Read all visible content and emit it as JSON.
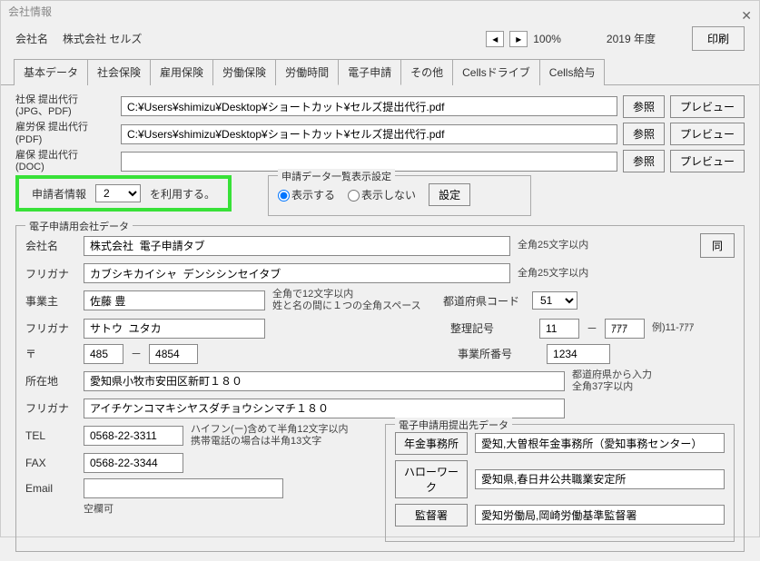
{
  "window": {
    "title": "会社情報"
  },
  "header": {
    "company_label": "会社名",
    "company_name": "株式会社 セルズ",
    "zoom": "100%",
    "year_value": "2019",
    "year_suffix": "年度",
    "print": "印刷"
  },
  "tabs": {
    "items": [
      "基本データ",
      "社会保険",
      "雇用保険",
      "労働保険",
      "労働時間",
      "電子申請",
      "その他",
      "Cellsドライブ",
      "Cells給与"
    ],
    "active": 5
  },
  "files": {
    "r0": {
      "label": "社保 提出代行\n(JPG、PDF)",
      "value": "C:¥Users¥shimizu¥Desktop¥ショートカット¥セルズ提出代行.pdf"
    },
    "r1": {
      "label": "雇労保 提出代行\n(PDF)",
      "value": "C:¥Users¥shimizu¥Desktop¥ショートカット¥セルズ提出代行.pdf"
    },
    "r2": {
      "label": "雇保 提出代行\n(DOC)",
      "value": ""
    },
    "browse": "参照",
    "preview": "プレビュー"
  },
  "applicant": {
    "label": "申請者情報",
    "value": "2",
    "suffix": "を利用する。"
  },
  "display_setting": {
    "legend": "申請データ一覧表示設定",
    "opt_show": "表示する",
    "opt_hide": "表示しない",
    "set_btn": "設定"
  },
  "company_data": {
    "legend": "電子申請用会社データ",
    "name_label": "会社名",
    "name_value": "株式会社  電子申請タブ",
    "name_hint": "全角25文字以内",
    "same_btn": "同",
    "kana_label": "フリガナ",
    "kana_value": "カブシキカイシャ  デンシシンセイタブ",
    "kana_hint": "全角25文字以内",
    "owner_label": "事業主",
    "owner_value": "佐藤 豊",
    "owner_hint": "全角で12文字以内\n姓と名の間に１つの全角スペース",
    "pref_label": "都道府県コード",
    "pref_value": "51",
    "owner_kana_label": "フリガナ",
    "owner_kana_value": "サトウ  ユタカ",
    "seiri_label": "整理記号",
    "seiri1": "11",
    "seiri_sep": "－",
    "seiri2": "ｱｱｱ",
    "seiri_hint": "例)11-ｱｱｱ",
    "zip_label": "〒",
    "zip1": "485",
    "zip_sep": "－",
    "zip2": "4854",
    "office_no_label": "事業所番号",
    "office_no_value": "1234",
    "addr_label": "所在地",
    "addr_value": "愛知県小牧市安田区新町１８０",
    "addr_hint": "都道府県から入力\n全角37字以内",
    "addr_kana_label": "フリガナ",
    "addr_kana_value": "アイチケンコマキシヤスダチョウシンマチ１８０",
    "tel_label": "TEL",
    "tel_value": "0568-22-3311",
    "tel_hint": "ハイフン(ー)含めて半角12文字以内\n携帯電話の場合は半角13文字",
    "fax_label": "FAX",
    "fax_value": "0568-22-3344",
    "email_label": "Email",
    "email_value": "",
    "email_hint": "空欄可"
  },
  "dest": {
    "legend": "電子申請用提出先データ",
    "pension_btn": "年金事務所",
    "pension_value": "愛知,大曽根年金事務所（愛知事務センター）",
    "hw_btn": "ハローワーク",
    "hw_value": "愛知県,春日井公共職業安定所",
    "kantoku_btn": "監督署",
    "kantoku_value": "愛知労働局,岡崎労働基準監督署"
  }
}
